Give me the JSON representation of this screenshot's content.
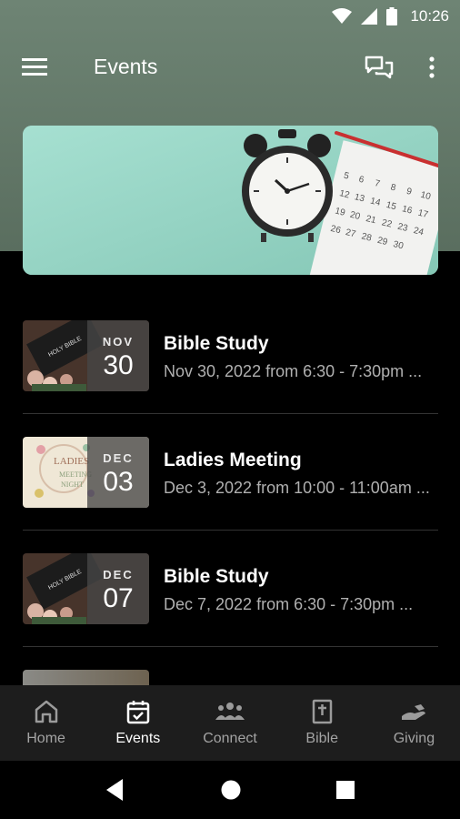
{
  "status_bar": {
    "time": "10:26",
    "icons": [
      "wifi-icon",
      "signal-icon",
      "battery-icon"
    ]
  },
  "app_bar": {
    "title": "Events",
    "icons": [
      "menu-icon",
      "chat-icon",
      "more-vert-icon"
    ]
  },
  "hero": {
    "image": "alarm-clock-calendar-photo",
    "accent": "#9ed8c9"
  },
  "events": [
    {
      "month": "NOV",
      "day": "30",
      "title": "Bible Study",
      "subtitle": "Nov 30, 2022 from 6:30 - 7:30pm ...",
      "thumb": "bible-thumb"
    },
    {
      "month": "DEC",
      "day": "03",
      "title": "Ladies Meeting",
      "subtitle": "Dec 3, 2022 from 10:00 - 11:00am ...",
      "thumb": "ladies-thumb"
    },
    {
      "month": "DEC",
      "day": "07",
      "title": "Bible Study",
      "subtitle": "Dec 7, 2022 from 6:30 - 7:30pm ...",
      "thumb": "bible-thumb"
    }
  ],
  "bottom_nav": [
    {
      "label": "Home",
      "icon": "home-icon",
      "active": false
    },
    {
      "label": "Events",
      "icon": "calendar-icon",
      "active": true
    },
    {
      "label": "Connect",
      "icon": "group-icon",
      "active": false
    },
    {
      "label": "Bible",
      "icon": "bible-icon",
      "active": false
    },
    {
      "label": "Giving",
      "icon": "giving-icon",
      "active": false
    }
  ],
  "system_nav": [
    "back-icon",
    "home-circle-icon",
    "recents-icon"
  ],
  "colors": {
    "header": "#627868",
    "background": "#000000",
    "nav_bg": "#1d1d1d",
    "subtitle": "#b0b0b0"
  }
}
